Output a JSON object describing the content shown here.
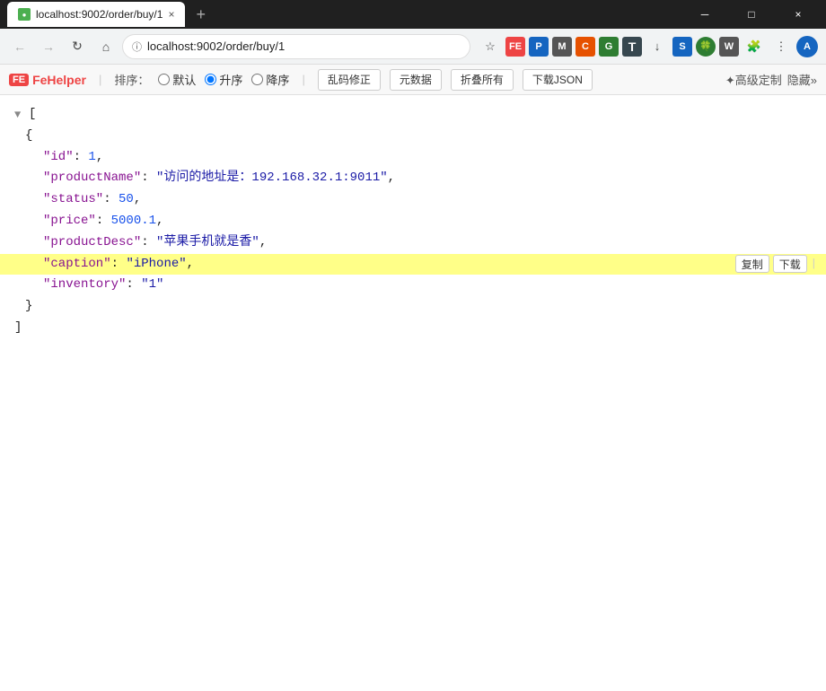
{
  "titlebar": {
    "favicon_label": "●",
    "tab_title": "localhost:9002/order/buy/1",
    "tab_close": "×",
    "new_tab": "+",
    "win_minimize": "─",
    "win_maximize": "□",
    "win_close": "×"
  },
  "navbar": {
    "back_label": "←",
    "forward_label": "→",
    "reload_label": "↻",
    "home_label": "⌂",
    "lock_label": "🔒",
    "url": "localhost:9002/order/buy/1",
    "star_label": "☆",
    "extensions_label": "⚙"
  },
  "fehelper": {
    "logo_fe": "FE",
    "logo_name": "FeHelper",
    "sort_label": "排序：",
    "radio_default": "默认",
    "radio_asc": "升序",
    "radio_desc": "降序",
    "btn_fix_encoding": "乱码修正",
    "btn_raw": "元数据",
    "btn_fold": "折叠所有",
    "btn_download": "下载JSON",
    "btn_advanced": "✦高级定制",
    "btn_hide": "隐藏»"
  },
  "json": {
    "data": [
      {
        "key": "id",
        "value": "1",
        "type": "number",
        "comma": ","
      },
      {
        "key": "productName",
        "value": "\"访问的地址是：192.168.32.1:9011\"",
        "type": "string",
        "comma": ","
      },
      {
        "key": "status",
        "value": "50",
        "type": "number",
        "comma": ","
      },
      {
        "key": "price",
        "value": "5000.1",
        "type": "number",
        "comma": ","
      },
      {
        "key": "productDesc",
        "value": "\"苹果手机就是香\"",
        "type": "string",
        "comma": ","
      },
      {
        "key": "caption",
        "value": "\"iPhone\"",
        "type": "string",
        "comma": ",",
        "highlighted": true
      },
      {
        "key": "inventory",
        "value": "\"1\"",
        "type": "string",
        "comma": ""
      }
    ],
    "line_action_copy": "复制",
    "line_action_download": "下载",
    "line_action_more": "|"
  },
  "colors": {
    "key_color": "#881391",
    "string_color": "#1a1aa6",
    "number_color": "#1750eb",
    "highlight_bg": "#ffff88"
  }
}
